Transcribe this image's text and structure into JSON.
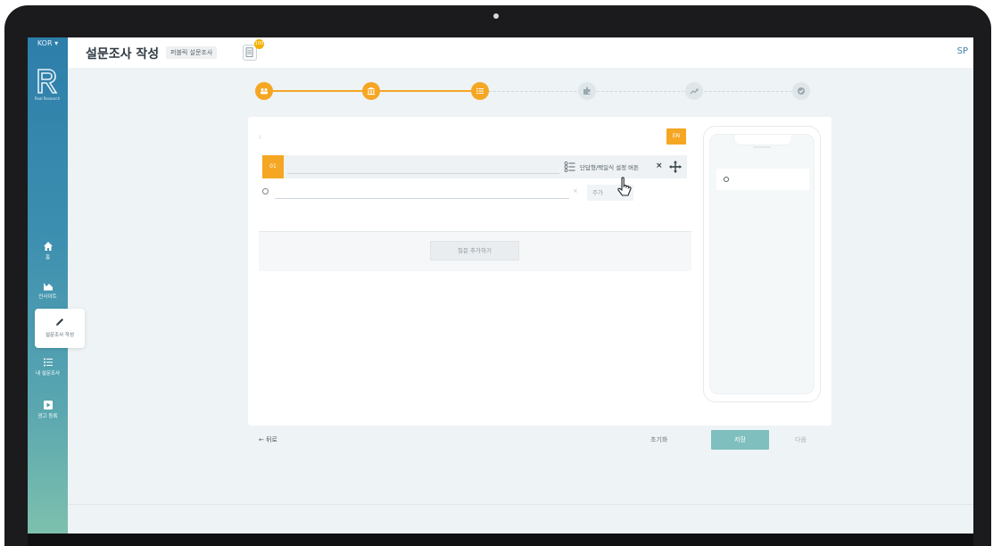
{
  "sidebar": {
    "language": "KOR ▾",
    "logo_text": "Real Research",
    "items": [
      {
        "label": "홈",
        "icon": "home-icon"
      },
      {
        "label": "인사이트",
        "icon": "chart-icon"
      },
      {
        "label": "설문조사 작성",
        "icon": "pencil-icon"
      },
      {
        "label": "내 설문조사",
        "icon": "list-icon"
      },
      {
        "label": "광고 등록",
        "icon": "play-icon"
      }
    ]
  },
  "header": {
    "title": "설문조사 작성",
    "survey_type": "퍼블릭 설문조사",
    "doc_badge": "100",
    "user_initials": "SP"
  },
  "steps": {
    "items": [
      {
        "icon": "people-icon",
        "status": "done"
      },
      {
        "icon": "bank-icon",
        "status": "done"
      },
      {
        "icon": "list-icon",
        "status": "done"
      },
      {
        "icon": "puzzle-icon",
        "status": "todo"
      },
      {
        "icon": "trend-icon",
        "status": "todo"
      },
      {
        "icon": "check-icon",
        "status": "todo"
      }
    ],
    "colors": {
      "done": "#f5a623",
      "todo": "#dfe6ea"
    }
  },
  "editor": {
    "info": "i",
    "lang_button": "EN",
    "question_number": "01",
    "question_value": "",
    "type_label": "단답형/택일식 설정 버튼",
    "close": "×",
    "option_value": "",
    "option_remove": "×",
    "option_add": "주가",
    "add_question": "질문 추가하기"
  },
  "footer": {
    "back": "← 뒤로",
    "reset": "초기화",
    "save": "저장",
    "next": "다음"
  }
}
